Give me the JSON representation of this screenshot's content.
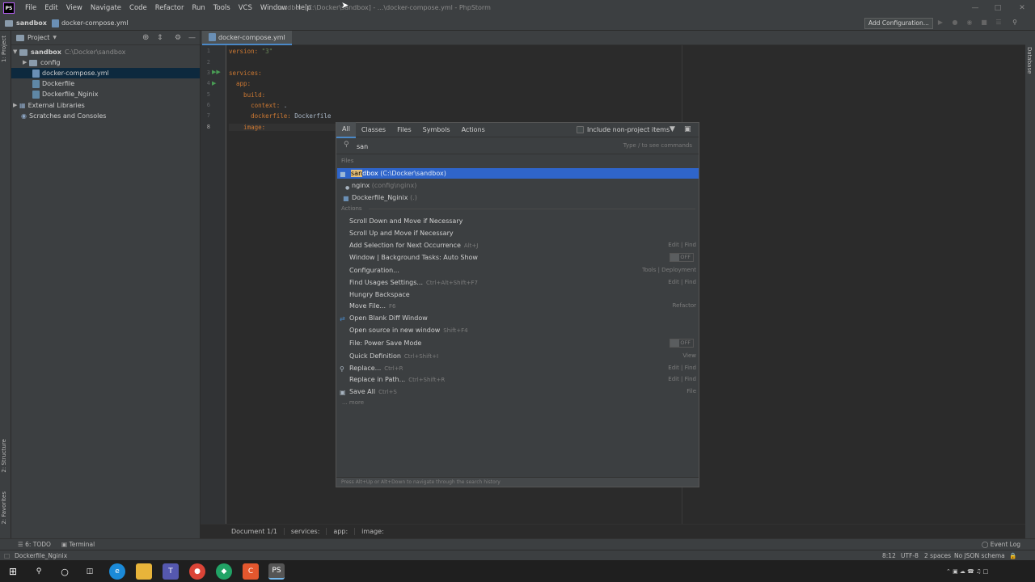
{
  "title_bar": {
    "logo": "PS",
    "menu": [
      "File",
      "Edit",
      "View",
      "Navigate",
      "Code",
      "Refactor",
      "Run",
      "Tools",
      "VCS",
      "Window",
      "Help"
    ],
    "window_title": "sandbox [C:\\Docker\\sandbox] - ...\\docker-compose.yml - PhpStorm"
  },
  "nav_bar": {
    "project": "sandbox",
    "file": "docker-compose.yml",
    "add_configuration": "Add Configuration..."
  },
  "left_stripe": {
    "project_tab": "1: Project",
    "structure_tab": "2: Structure",
    "favorites_tab": "2: Favorites"
  },
  "right_stripe": {
    "database_tab": "Database"
  },
  "project_panel": {
    "header": "Project",
    "tree": [
      {
        "label": "sandbox",
        "path": "C:\\Docker\\sandbox"
      },
      {
        "label": "config"
      },
      {
        "label": "docker-compose.yml"
      },
      {
        "label": "Dockerfile"
      },
      {
        "label": "Dockerfile_Nginix"
      },
      {
        "label": "External Libraries"
      },
      {
        "label": "Scratches and Consoles"
      }
    ]
  },
  "editor": {
    "tab": "docker-compose.yml",
    "line_numbers": [
      "1",
      "2",
      "3",
      "4",
      "5",
      "6",
      "7",
      "8"
    ],
    "lines": [
      {
        "k": "version:",
        "v": " \"3\""
      },
      {
        "k": "",
        "v": ""
      },
      {
        "k": "services:",
        "v": ""
      },
      {
        "k": "  app:",
        "v": ""
      },
      {
        "k": "    build:",
        "v": ""
      },
      {
        "k": "      context:",
        "v": " ."
      },
      {
        "k": "      dockerfile:",
        "v": " Dockerfile"
      },
      {
        "k": "    image:",
        "v": ""
      }
    ],
    "breadcrumbs": [
      "Document 1/1",
      "services:",
      "app:",
      "image:"
    ]
  },
  "popup": {
    "tabs": [
      "All",
      "Classes",
      "Files",
      "Symbols",
      "Actions"
    ],
    "include_non_project": "Include non-project items",
    "query": "san",
    "hint": "Type / to see commands",
    "files_header": "Files",
    "files": [
      {
        "name_hl": "san",
        "name_rest": "dbox",
        "path": "(C:\\Docker\\sandbox)"
      },
      {
        "name": "nginx",
        "path": "(config\\nginx)"
      },
      {
        "name": "Dockerfile_Nginix",
        "path": "(.)"
      }
    ],
    "actions_header": "Actions",
    "actions": [
      {
        "name": "Scroll Down and Move if Necessary",
        "shortcut": "",
        "category": ""
      },
      {
        "name": "Scroll Up and Move if Necessary",
        "shortcut": "",
        "category": ""
      },
      {
        "name": "Add Selection for Next Occurrence",
        "shortcut": "Alt+J",
        "category": "Edit | Find"
      },
      {
        "name": "Window | Background Tasks: Auto Show",
        "shortcut": "",
        "category": "",
        "toggle": "OFF"
      },
      {
        "name": "Configuration...",
        "shortcut": "",
        "category": "Tools | Deployment"
      },
      {
        "name": "Find Usages Settings...",
        "shortcut": "Ctrl+Alt+Shift+F7",
        "category": "Edit | Find"
      },
      {
        "name": "Hungry Backspace",
        "shortcut": "",
        "category": ""
      },
      {
        "name": "Move File...",
        "shortcut": "F6",
        "category": "Refactor"
      },
      {
        "name": "Open Blank Diff Window",
        "shortcut": "",
        "category": ""
      },
      {
        "name": "Open source in new window",
        "shortcut": "Shift+F4",
        "category": ""
      },
      {
        "name": "File: Power Save Mode",
        "shortcut": "",
        "category": "",
        "toggle": "OFF"
      },
      {
        "name": "Quick Definition",
        "shortcut": "Ctrl+Shift+I",
        "category": "View"
      },
      {
        "name": "Replace...",
        "shortcut": "Ctrl+R",
        "category": "Edit | Find"
      },
      {
        "name": "Replace in Path...",
        "shortcut": "Ctrl+Shift+R",
        "category": "Edit | Find"
      },
      {
        "name": "Save All",
        "shortcut": "Ctrl+S",
        "category": "File"
      }
    ],
    "more": "... more",
    "footer": "Press Alt+Up or Alt+Down to navigate through the search history"
  },
  "bottom_bar": {
    "todo": "6: TODO",
    "terminal": "Terminal",
    "event_log": "Event Log"
  },
  "status_bar": {
    "file": "Dockerfile_Nginix",
    "position": "8:12",
    "encoding": "UTF-8",
    "indent": "2 spaces",
    "schema": "No JSON schema"
  },
  "colors": {
    "accent": "#4a88c7",
    "selection": "#2f65ca",
    "background": "#2b2b2b",
    "panel": "#3c3f41"
  }
}
